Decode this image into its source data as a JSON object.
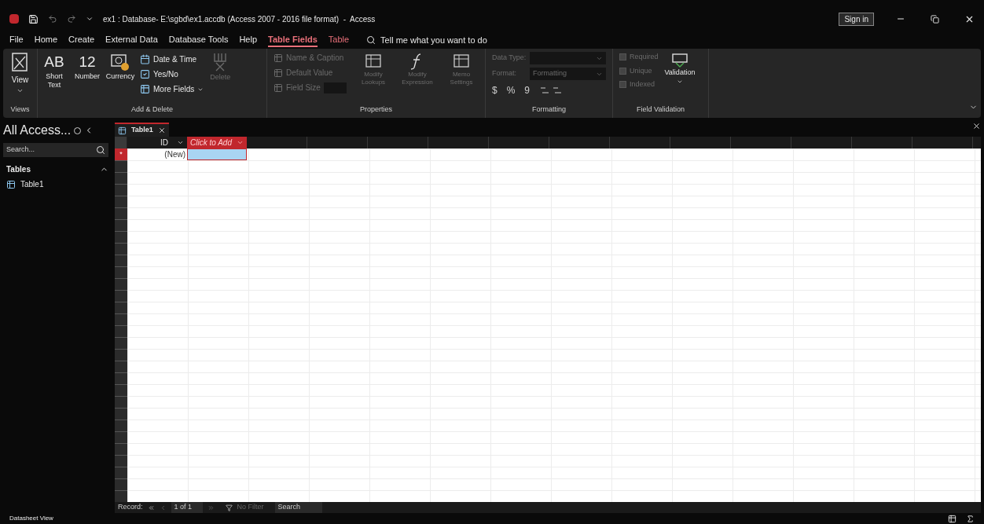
{
  "window": {
    "title": "ex1 : Database- E:\\sgbd\\ex1.accdb (Access 2007 - 2016 file format)  -  Access",
    "sign_in": "Sign in"
  },
  "menu": [
    {
      "label": "File",
      "selected": false,
      "kind": "plain"
    },
    {
      "label": "Home",
      "selected": false,
      "kind": "plain"
    },
    {
      "label": "Create",
      "selected": false,
      "kind": "plain"
    },
    {
      "label": "External Data",
      "selected": false,
      "kind": "plain"
    },
    {
      "label": "Database Tools",
      "selected": false,
      "kind": "plain"
    },
    {
      "label": "Help",
      "selected": false,
      "kind": "plain"
    },
    {
      "label": "Table Fields",
      "selected": true,
      "kind": "contextual"
    },
    {
      "label": "Table",
      "selected": false,
      "kind": "contextual"
    }
  ],
  "tell_me": "Tell me what you want to do",
  "ribbon": {
    "views": {
      "label": "Views",
      "view_button": "View"
    },
    "add_delete": {
      "label": "Add & Delete",
      "large": [
        {
          "glyph": "AB",
          "label": "Short Text"
        },
        {
          "glyph": "12",
          "label": "Number"
        },
        {
          "label": "Currency"
        }
      ],
      "small": [
        {
          "label": "Date & Time"
        },
        {
          "label": "Yes/No"
        },
        {
          "label": "More Fields"
        }
      ],
      "delete": {
        "label": "Delete",
        "disabled": true
      }
    },
    "properties": {
      "label": "Properties",
      "small": [
        {
          "label": "Name & Caption",
          "disabled": true
        },
        {
          "label": "Default Value",
          "disabled": true
        },
        {
          "label": "Field Size",
          "disabled": true
        }
      ],
      "large": [
        {
          "label": "Modify Lookups",
          "disabled": true
        },
        {
          "label": "Modify Expression",
          "disabled": true
        },
        {
          "label": "Memo Settings",
          "disabled": true
        }
      ]
    },
    "formatting": {
      "label": "Formatting",
      "data_type": "Data Type:",
      "format": "Format:",
      "format_placeholder": "Formatting",
      "symbols": [
        "$",
        "%",
        "9"
      ]
    },
    "field_validation": {
      "label": "Field Validation",
      "checks": [
        {
          "label": "Required",
          "checked": false,
          "disabled": true
        },
        {
          "label": "Unique",
          "checked": false,
          "disabled": true
        },
        {
          "label": "Indexed",
          "checked": false,
          "disabled": true
        }
      ],
      "validation": "Validation"
    }
  },
  "nav_pane": {
    "title": "All Access...",
    "search_placeholder": "Search...",
    "groups": [
      {
        "label": "Tables",
        "expanded": true,
        "items": [
          "Table1"
        ]
      }
    ]
  },
  "doc_tabs": [
    {
      "label": "Table1",
      "selected": true
    }
  ],
  "datasheet": {
    "columns": [
      {
        "label": "ID",
        "kind": "field"
      },
      {
        "label": "Click to Add",
        "kind": "add"
      }
    ],
    "new_row": "(New)",
    "new_row_marker": "*"
  },
  "record_nav": {
    "label": "Record:",
    "position": "1 of 1",
    "filter": "No Filter",
    "search": "Search"
  },
  "status_bar": "Datasheet View"
}
